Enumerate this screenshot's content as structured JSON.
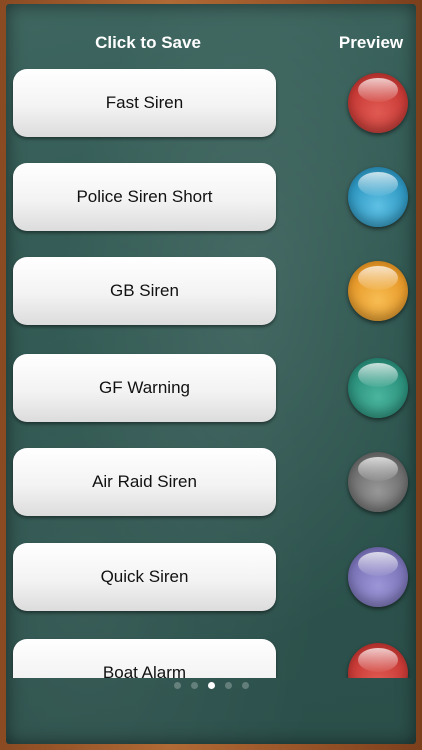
{
  "header": {
    "save_label": "Click to Save",
    "preview_label": "Preview"
  },
  "sounds": [
    {
      "label": "Fast Siren",
      "color": "#c93a36",
      "icon": "preview-orb-red"
    },
    {
      "label": "Police Siren Short",
      "color": "#2f98c2",
      "icon": "preview-orb-blue"
    },
    {
      "label": "GB Siren",
      "color": "#e89a2a",
      "icon": "preview-orb-orange"
    },
    {
      "label": "GF Warning",
      "color": "#2b917c",
      "icon": "preview-orb-teal"
    },
    {
      "label": "Air Raid Siren",
      "color": "#6f6f6f",
      "icon": "preview-orb-gray"
    },
    {
      "label": "Quick Siren",
      "color": "#7b74b8",
      "icon": "preview-orb-purple"
    },
    {
      "label": "Boat Alarm",
      "color": "#c93a36",
      "icon": "preview-orb-red"
    }
  ],
  "pagination": {
    "total": 5,
    "current": 3
  }
}
